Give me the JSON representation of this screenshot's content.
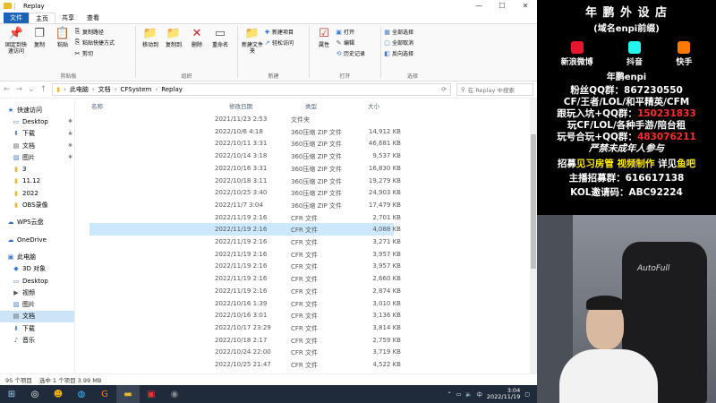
{
  "window": {
    "title": "Replay"
  },
  "ribbon_tabs": [
    "文件",
    "主页",
    "共享",
    "查看"
  ],
  "ribbon": {
    "clipboard": {
      "label": "剪贴板",
      "pin": "固定到快速访问",
      "copy": "复制",
      "paste": "粘贴",
      "copy_path": "复制路径",
      "paste_shortcut": "粘贴快捷方式",
      "cut": "剪切"
    },
    "organize": {
      "label": "组织",
      "move_to": "移动到",
      "copy_to": "复制到",
      "delete": "删除",
      "rename": "重命名"
    },
    "new": {
      "label": "新建",
      "new_folder": "新建文件夹",
      "new_item": "新建项目",
      "easy_access": "轻松访问"
    },
    "open": {
      "label": "打开",
      "properties": "属性",
      "open": "打开",
      "edit": "编辑",
      "history": "历史记录"
    },
    "select": {
      "label": "选择",
      "select_all": "全部选择",
      "select_none": "全部取消",
      "invert": "反向选择"
    }
  },
  "address": {
    "crumbs": [
      "此电脑",
      "文档",
      "CFSystem",
      "Replay"
    ],
    "search_placeholder": "在 Replay 中搜索"
  },
  "nav": {
    "items": [
      {
        "label": "快速访问",
        "icon": "star-icon",
        "pinned": false,
        "selected": false
      },
      {
        "label": "Desktop",
        "icon": "desktop-icon",
        "pinned": true,
        "selected": false
      },
      {
        "label": "下载",
        "icon": "download-icon",
        "pinned": true,
        "selected": false
      },
      {
        "label": "文档",
        "icon": "document-icon",
        "pinned": true,
        "selected": false
      },
      {
        "label": "图片",
        "icon": "picture-icon",
        "pinned": true,
        "selected": false
      },
      {
        "label": "3",
        "icon": "folder-icon",
        "pinned": false,
        "selected": false
      },
      {
        "label": "11.12",
        "icon": "folder-icon",
        "pinned": false,
        "selected": false
      },
      {
        "label": "2022",
        "icon": "folder-icon",
        "pinned": false,
        "selected": false
      },
      {
        "label": "OBS录像",
        "icon": "folder-icon",
        "pinned": false,
        "selected": false
      },
      {
        "label": "WPS云盘",
        "icon": "cloud-icon",
        "pinned": false,
        "selected": false
      },
      {
        "label": "OneDrive",
        "icon": "onedrive-icon",
        "pinned": false,
        "selected": false
      },
      {
        "label": "此电脑",
        "icon": "computer-icon",
        "pinned": false,
        "selected": false
      },
      {
        "label": "3D 对象",
        "icon": "cube-icon",
        "pinned": false,
        "selected": false
      },
      {
        "label": "Desktop",
        "icon": "desktop-icon",
        "pinned": false,
        "selected": false
      },
      {
        "label": "视频",
        "icon": "video-icon",
        "pinned": false,
        "selected": false
      },
      {
        "label": "图片",
        "icon": "picture-icon",
        "pinned": false,
        "selected": false
      },
      {
        "label": "文档",
        "icon": "document-icon",
        "pinned": false,
        "selected": true
      },
      {
        "label": "下载",
        "icon": "download-icon",
        "pinned": false,
        "selected": false
      },
      {
        "label": "音乐",
        "icon": "music-icon",
        "pinned": false,
        "selected": false
      }
    ]
  },
  "columns": {
    "name": "名称",
    "date": "修改日期",
    "type": "类型",
    "size": "大小"
  },
  "files": [
    {
      "name": "演员",
      "date": "2021/11/23 2:53",
      "type": "文件夹",
      "size": "",
      "kind": "folder"
    },
    {
      "name": "10.2",
      "date": "2022/10/6 4:18",
      "type": "360压缩 ZIP 文件",
      "size": "14,912 KB",
      "kind": "zip"
    },
    {
      "name": "10.8",
      "date": "2022/10/11 3:31",
      "type": "360压缩 ZIP 文件",
      "size": "46,681 KB",
      "kind": "zip"
    },
    {
      "name": "10.14",
      "date": "2022/10/14 3:18",
      "type": "360压缩 ZIP 文件",
      "size": "9,537 KB",
      "kind": "zip"
    },
    {
      "name": "10.15",
      "date": "2022/10/16 3:31",
      "type": "360压缩 ZIP 文件",
      "size": "16,830 KB",
      "kind": "zip"
    },
    {
      "name": "10.18",
      "date": "2022/10/18 3:11",
      "type": "360压缩 ZIP 文件",
      "size": "19,279 KB",
      "kind": "zip"
    },
    {
      "name": "10.25",
      "date": "2022/10/25 3:40",
      "type": "360压缩 ZIP 文件",
      "size": "24,903 KB",
      "kind": "zip"
    },
    {
      "name": "11.5",
      "date": "2022/11/7 3:04",
      "type": "360压缩 ZIP 文件",
      "size": "17,479 KB",
      "kind": "zip"
    },
    {
      "name": "2022年11月18日 20：00分 北部 id：金...",
      "date": "2022/11/19 2:16",
      "type": "CFR 文件",
      "size": "2,701 KB",
      "kind": "doc"
    },
    {
      "name": "20221117山东一区a1345684326第一位在家自动下包.cfr",
      "date": "2022/11/19 2:16",
      "type": "CFR 文件",
      "size": "4,088 KB",
      "kind": "doc",
      "renaming": true
    },
    {
      "name": "20221118-22.10 北部滚塌战怼5分30秒...",
      "date": "2022/11/19 2:16",
      "type": "CFR 文件",
      "size": "3,271 KB",
      "kind": "doc"
    },
    {
      "name": "20221118-22.30-北部-伊昭就要闻-全程...",
      "date": "2022/11/19 2:16",
      "type": "CFR 文件",
      "size": "3,957 KB",
      "kind": "doc"
    },
    {
      "name": "20221118-22.35-北部-伊昭就要闻-全程...",
      "date": "2022/11/19 2:16",
      "type": "CFR 文件",
      "size": "3,957 KB",
      "kind": "doc"
    },
    {
      "name": "20221118-22.40-部-恐伊（每个点不会...",
      "date": "2022/11/19 2:16",
      "type": "CFR 文件",
      "size": "2,660 KB",
      "kind": "doc"
    },
    {
      "name": "20221118山东一区无情砸头透视.cfr",
      "date": "2022/11/19 2:16",
      "type": "CFR 文件",
      "size": "2,874 KB",
      "kind": "doc"
    },
    {
      "name": "CFReplay20221016_0000.cfr",
      "date": "2022/10/16 1:39",
      "type": "CFR 文件",
      "size": "3,010 KB",
      "kind": "doc"
    },
    {
      "name": "CFReplay20221016_0001.cfr",
      "date": "2022/10/16 3:01",
      "type": "CFR 文件",
      "size": "3,136 KB",
      "kind": "doc"
    },
    {
      "name": "CFReplay20221017_0001.cfr",
      "date": "2022/10/17 23:29",
      "type": "CFR 文件",
      "size": "3,814 KB",
      "kind": "doc"
    },
    {
      "name": "CFReplay20221018_0000.cfr",
      "date": "2022/10/18 2:17",
      "type": "CFR 文件",
      "size": "2,759 KB",
      "kind": "doc"
    },
    {
      "name": "CFReplay20221024_0000.cfr",
      "date": "2022/10/24 22:00",
      "type": "CFR 文件",
      "size": "3,719 KB",
      "kind": "doc"
    },
    {
      "name": "CFReplay20221025_0000.cfr",
      "date": "2022/10/25 21:47",
      "type": "CFR 文件",
      "size": "4,522 KB",
      "kind": "doc"
    },
    {
      "name": "CFReplay20221025_0001.cfr",
      "date": "2022/10/25 21:58",
      "type": "CFR 文件",
      "size": "3,914 KB",
      "kind": "doc"
    },
    {
      "name": "CFReplay20221025_0002.cfr",
      "date": "2022/10/25 22:13",
      "type": "CFR 文件",
      "size": "4,636 KB",
      "kind": "doc"
    }
  ],
  "status": {
    "count": "95 个项目",
    "selected": "选中 1 个项目  3.99 MB"
  },
  "taskbar": {
    "time": "3:04",
    "date": "2022/11/19",
    "lang": "中"
  },
  "overlay": {
    "title": "年 鹏 外 设 店",
    "subtitle": "(域名enpi前缀)",
    "socials": [
      {
        "label": "新浪微博",
        "color": "#e6162d"
      },
      {
        "label": "抖音",
        "color": "#25f4ee"
      },
      {
        "label": "快手",
        "color": "#ff7a00"
      }
    ],
    "name": "年鹏enpi",
    "line1_label": "粉丝QQ群：",
    "line1_value": "867230550",
    "line2": "CF/王者/LOL/和平精英/CFM",
    "line3": "跟玩入坑+QQ群：",
    "line3_value": "150231833",
    "line4": "玩CF/LOL/各种手游/陪台租",
    "line5": "玩号合玩+QQ群：",
    "line5_value": "483076211",
    "line6": "严禁未成年人参与",
    "line7_a": "招募",
    "line7_b": "见习房管",
    "line7_c": "视频制作",
    "line7_d": "详见",
    "line7_e": "鱼吧",
    "line8_label": "主播招募群：",
    "line8_value": "616617138",
    "line9_label": "KOL邀请码：",
    "line9_value": "ABC92224"
  },
  "webcam": {
    "chair_logo": "AutoFull"
  }
}
